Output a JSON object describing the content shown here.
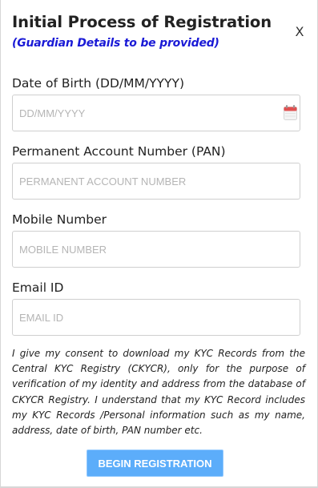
{
  "header": {
    "title": "Initial Process of Registration",
    "subtitle": "(Guardian Details to be provided)",
    "close_label": "X"
  },
  "form": {
    "dob": {
      "label": "Date of Birth (DD/MM/YYYY)",
      "placeholder": "DD/MM/YYYY",
      "value": "",
      "icon": "calendar-icon"
    },
    "pan": {
      "label": "Permanent Account Number (PAN)",
      "placeholder": "PERMANENT ACCOUNT NUMBER",
      "value": ""
    },
    "mobile": {
      "label": "Mobile Number",
      "placeholder": "MOBILE NUMBER",
      "value": ""
    },
    "email": {
      "label": "Email ID",
      "placeholder": "EMAIL ID",
      "value": ""
    }
  },
  "consent": {
    "text": "I give my consent to download my KYC Records from the Central KYC Registry (CKYCR), only for the purpose of verification of my identity and address from the database of CKYCR Registry. I understand that my KYC Record includes my KYC Records /Personal information such as my name, address, date of birth, PAN number etc."
  },
  "actions": {
    "submit_label": "BEGIN REGISTRATION"
  },
  "colors": {
    "subtitle": "#1a1ad6",
    "button_bg": "#5cadfa",
    "button_text": "#ffffff",
    "calendar_icon": "#e05050"
  }
}
